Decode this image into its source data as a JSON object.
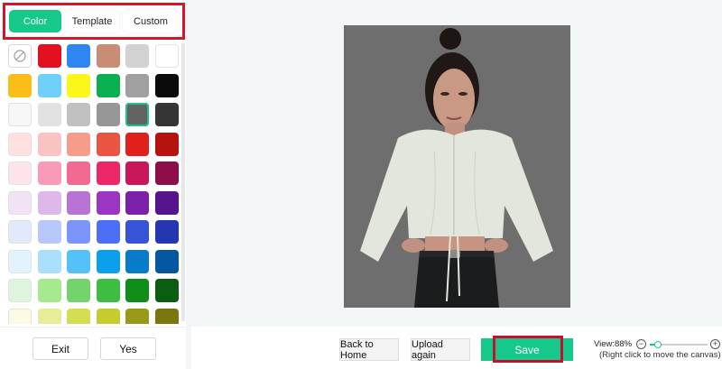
{
  "tabs": [
    {
      "label": "Color",
      "active": true
    },
    {
      "label": "Template",
      "active": false
    },
    {
      "label": "Custom",
      "active": false
    }
  ],
  "swatches": [
    [
      "none",
      "#e3101f",
      "#2d86f2",
      "#c98d75",
      "#d2d2d2",
      "#ffffff"
    ],
    [
      "#fbbe16",
      "#6fd0fb",
      "#fbf71a",
      "#0aaf50",
      "#a0a0a0",
      "#0a0a0a"
    ],
    [
      "#f7f7f7",
      "#e1e1e1",
      "#c1c1c1",
      "#979797",
      "#636363",
      "#353535"
    ],
    [
      "#fde1df",
      "#f9c3c1",
      "#f69c8b",
      "#e95443",
      "#e0201d",
      "#b5140e"
    ],
    [
      "#fde4ea",
      "#f79bb6",
      "#f06a92",
      "#ec2667",
      "#c8185a",
      "#8f0d4a"
    ],
    [
      "#f1e3f5",
      "#ddb9ea",
      "#b774d4",
      "#9a36c2",
      "#7b21a9",
      "#54158d"
    ],
    [
      "#e3e9fd",
      "#b7c7fb",
      "#7c95fa",
      "#4d6ff5",
      "#3854d6",
      "#2437b1"
    ],
    [
      "#e1f4fd",
      "#a9dffb",
      "#54c2f8",
      "#0aa0ec",
      "#087bca",
      "#0557a0"
    ],
    [
      "#dcf5dc",
      "#a6e98e",
      "#74d36c",
      "#3ebd43",
      "#108d18",
      "#0b5d10"
    ],
    [
      "#fbfbe3",
      "#e6ec97",
      "#d5dd53",
      "#c4cd2d",
      "#999a1a",
      "#7b7710"
    ]
  ],
  "selected_swatch": "#636363",
  "footer": {
    "exit_label": "Exit",
    "yes_label": "Yes"
  },
  "bottom_bar": {
    "back_home_label": "Back to Home",
    "upload_label": "Upload again",
    "save_label": "Save",
    "zoom_text": "View:88%",
    "zoom_level": 0.88,
    "hint_text": "(Right click to move the canvas)",
    "zoom_minus": "−",
    "zoom_plus": "+"
  },
  "canvas": {
    "background_color": "#6e6e6e"
  },
  "colors": {
    "accent": "#16c98a",
    "highlight_border": "#d9142a"
  }
}
